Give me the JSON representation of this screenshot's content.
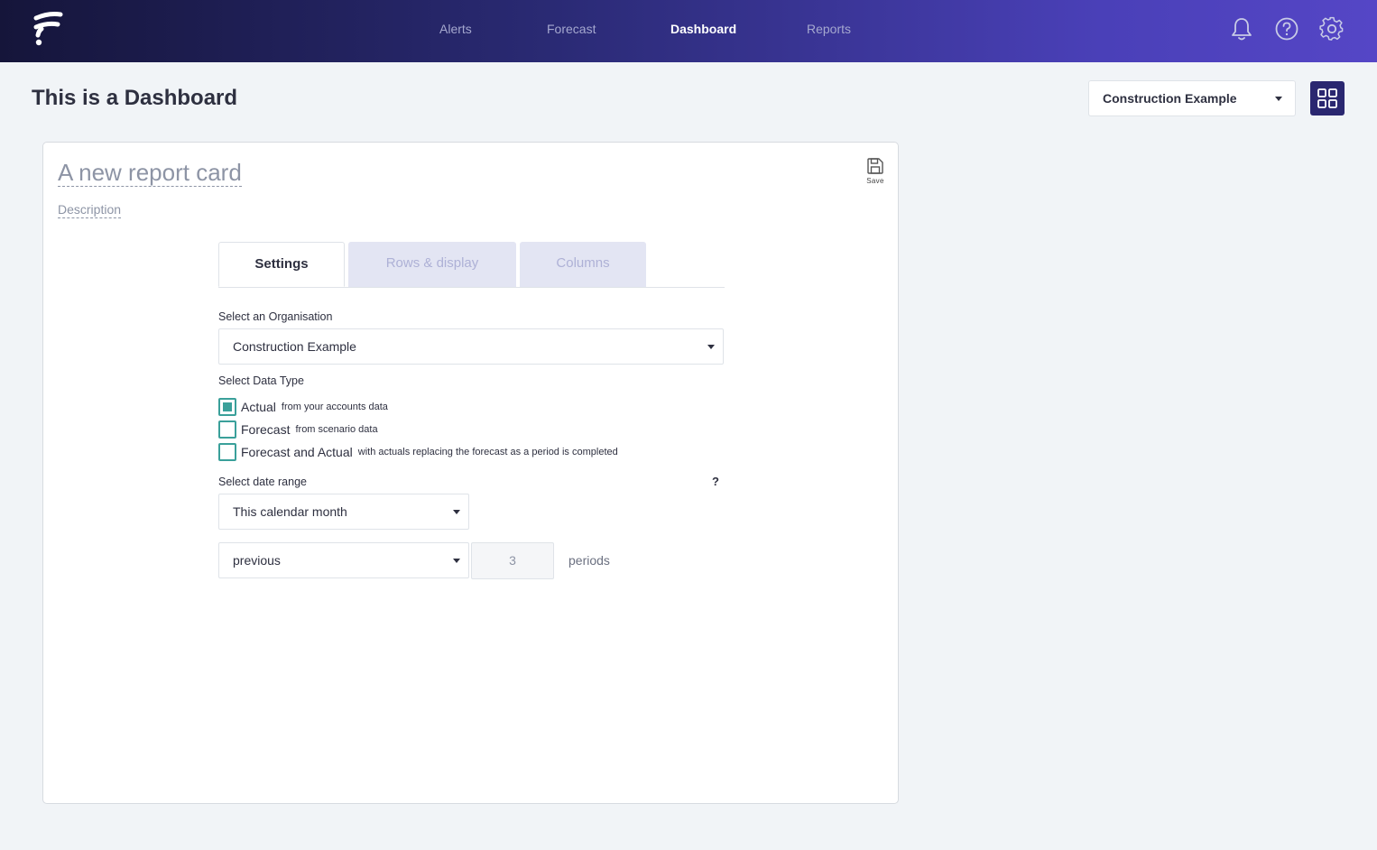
{
  "nav": {
    "items": [
      {
        "label": "Alerts"
      },
      {
        "label": "Forecast"
      },
      {
        "label": "Dashboard",
        "active": true
      },
      {
        "label": "Reports"
      }
    ],
    "icons": [
      "bell-icon",
      "help-circle-icon",
      "gear-icon"
    ]
  },
  "page": {
    "title": "This is a Dashboard",
    "org_select": "Construction Example"
  },
  "card": {
    "title": "A new report card",
    "description": "Description",
    "save_label": "Save",
    "tabs": [
      {
        "label": "Settings",
        "active": true
      },
      {
        "label": "Rows & display"
      },
      {
        "label": "Columns"
      }
    ],
    "org_label": "Select an Organisation",
    "org_value": "Construction Example",
    "data_type_label": "Select Data Type",
    "data_types": [
      {
        "label": "Actual",
        "sub": "from your accounts data",
        "checked": true
      },
      {
        "label": "Forecast",
        "sub": "from scenario data",
        "checked": false
      },
      {
        "label": "Forecast and Actual",
        "sub": "with actuals replacing the forecast as a period is completed",
        "checked": false
      }
    ],
    "date_range_label": "Select date range",
    "help": "?",
    "date_range_value": "This calendar month",
    "period_direction": "previous",
    "period_count": "3",
    "periods_label": "periods"
  },
  "colors": {
    "accent": "#3aa09a",
    "nav_start": "#15153a",
    "nav_end": "#5546c6",
    "grid_button": "#2a2770"
  }
}
